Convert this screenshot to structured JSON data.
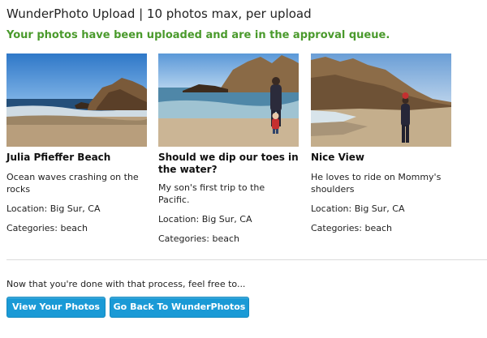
{
  "header": {
    "title": "WunderPhoto Upload | 10 photos max, per upload",
    "success_message": "Your photos have been uploaded and are in the approval queue."
  },
  "photos": [
    {
      "title": "Julia Pfieffer Beach",
      "description": "Ocean waves crashing on the rocks",
      "location": "Location: Big Sur, CA",
      "categories": "Categories: beach"
    },
    {
      "title": "Should we dip our toes in the water?",
      "description": "My son's first trip to the Pacific.",
      "location": "Location: Big Sur, CA",
      "categories": "Categories: beach"
    },
    {
      "title": "Nice View",
      "description": "He loves to ride on Mommy's shoulders",
      "location": "Location: Big Sur, CA",
      "categories": "Categories: beach"
    }
  ],
  "footer": {
    "prompt": "Now that you're done with that process, feel free to...",
    "view_photos_label": "View Your Photos",
    "back_label": "Go Back To WunderPhotos"
  },
  "colors": {
    "success": "#4a9a2c",
    "button": "#1a9ad6"
  }
}
